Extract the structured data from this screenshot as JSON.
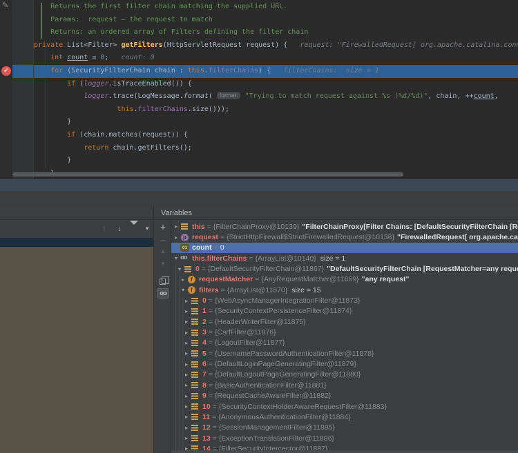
{
  "editor": {
    "breakpoint": "verified-breakpoint",
    "code_lines": [
      {
        "indent": 4,
        "name": "doc-comment-line",
        "segments": [
          {
            "t": "Returns the first filter chain matching the supplied URL.",
            "s": "cmt"
          }
        ]
      },
      {
        "indent": 4,
        "name": "doc-comment-line",
        "segments": [
          {
            "t": "Params:  request – the request to match",
            "s": "cmt"
          }
        ]
      },
      {
        "indent": 4,
        "name": "doc-comment-line",
        "segments": [
          {
            "t": "Returns: an ordered array of Filters defining the filter chain",
            "s": "cmt"
          }
        ]
      },
      {
        "indent": 0,
        "name": "method-signature-line",
        "segments": [
          {
            "t": "private",
            "s": "kw"
          },
          {
            "t": " List<Filter> ",
            "s": "pl"
          },
          {
            "t": "getFilters",
            "s": "mth"
          },
          {
            "t": "(HttpServletRequest request) {",
            "s": "pl"
          },
          {
            "t": "   request: \"FirewalledRequest[ org.apache.catalina.conn",
            "s": "hint"
          }
        ]
      },
      {
        "indent": 4,
        "name": "code-line",
        "segments": [
          {
            "t": "int ",
            "s": "kw"
          },
          {
            "t": "count",
            "s": "und"
          },
          {
            "t": " = ",
            "s": "pl"
          },
          {
            "t": "0",
            "s": "num"
          },
          {
            "t": ";",
            "s": "pl"
          },
          {
            "t": "   count: 0",
            "s": "hint"
          }
        ]
      },
      {
        "indent": 4,
        "name": "execution-line",
        "segments": [
          {
            "t": "for",
            "s": "kw"
          },
          {
            "t": " (SecurityFilterChain chain : ",
            "s": "pl"
          },
          {
            "t": "this",
            "s": "kw"
          },
          {
            "t": ".",
            "s": "pl"
          },
          {
            "t": "filterChains",
            "s": "fld"
          },
          {
            "t": ") {",
            "s": "pl"
          },
          {
            "t": "   filterChains:  size = 1",
            "s": "hint"
          }
        ]
      },
      {
        "indent": 8,
        "name": "code-line",
        "segments": [
          {
            "t": "if",
            "s": "kw"
          },
          {
            "t": " (",
            "s": "pl"
          },
          {
            "t": "logger",
            "s": "fldi"
          },
          {
            "t": ".isTraceEnabled()) {",
            "s": "pl"
          }
        ]
      },
      {
        "indent": 12,
        "name": "code-line",
        "segments": [
          {
            "t": "logger",
            "s": "fldi"
          },
          {
            "t": ".trace(LogMessage.",
            "s": "pl"
          },
          {
            "t": "format",
            "s": "pli"
          },
          {
            "t": "( ",
            "s": "pl"
          },
          {
            "t": "format:",
            "s": "chip"
          },
          {
            "t": " \"Trying to match request against %s (%d/%d)\"",
            "s": "str"
          },
          {
            "t": ", chain, ++",
            "s": "pl"
          },
          {
            "t": "count",
            "s": "und"
          },
          {
            "t": ",",
            "s": "pl"
          }
        ]
      },
      {
        "indent": 20,
        "name": "code-line",
        "segments": [
          {
            "t": "this",
            "s": "kw"
          },
          {
            "t": ".",
            "s": "pl"
          },
          {
            "t": "filterChains",
            "s": "fld"
          },
          {
            "t": ".size()));",
            "s": "pl"
          }
        ]
      },
      {
        "indent": 8,
        "name": "code-line",
        "segments": [
          {
            "t": "}",
            "s": "pl"
          }
        ]
      },
      {
        "indent": 8,
        "name": "code-line",
        "segments": [
          {
            "t": "if",
            "s": "kw"
          },
          {
            "t": " (chain.matches(request)) {",
            "s": "pl"
          }
        ]
      },
      {
        "indent": 12,
        "name": "code-line",
        "segments": [
          {
            "t": "return",
            "s": "kw"
          },
          {
            "t": " chain.getFilters();",
            "s": "pl"
          }
        ]
      },
      {
        "indent": 8,
        "name": "code-line",
        "segments": [
          {
            "t": "}",
            "s": "pl"
          }
        ]
      },
      {
        "indent": 4,
        "name": "code-line",
        "segments": [
          {
            "t": "}",
            "s": "pl"
          }
        ]
      }
    ]
  },
  "debugger": {
    "variables_panel_title": "Variables",
    "frames_toolbar": [
      {
        "icon": "arrow-up-icon",
        "glyph": "↑",
        "dim": true
      },
      {
        "icon": "arrow-down-icon",
        "glyph": "↓",
        "dim": false
      },
      {
        "icon": "filter-icon"
      },
      {
        "icon": "chevron-down-icon",
        "glyph": "▾",
        "dim": false
      }
    ],
    "watch_toolbar": [
      {
        "icon": "add-watch-icon",
        "glyph": "+"
      },
      {
        "icon": "remove-watch-icon",
        "glyph": "−"
      },
      {
        "icon": "move-up-icon",
        "glyph": "▲"
      },
      {
        "icon": "move-down-icon",
        "glyph": "▼"
      },
      {
        "icon": "duplicate-icon"
      },
      {
        "icon": "show-watches-toggle",
        "glyph": "oo"
      }
    ],
    "variables": [
      {
        "level": 0,
        "expand": "closed",
        "icon": "bars",
        "name": "this",
        "ref": "{FilterChainProxy@10139}",
        "str": "\"FilterChainProxy[Filter Chains: [DefaultSecurityFilterChain [RequestMatcher=any req"
      },
      {
        "level": 0,
        "expand": "closed",
        "icon": "param",
        "name": "request",
        "ref": "{StrictHttpFirewall$StrictFirewalledRequest@10138}",
        "str": "\"FirewalledRequest[ org.apache.catalina.connector.Requ"
      },
      {
        "level": 0,
        "expand": "none",
        "icon": "prim",
        "name": "count",
        "val": "0",
        "selected": true
      },
      {
        "level": 0,
        "expand": "open",
        "icon": "watch",
        "name": "this.filterChains",
        "ref": "{ArrayList@10140}",
        "size": "size = 1"
      },
      {
        "level": 1,
        "expand": "open",
        "icon": "bars",
        "name": "0",
        "ref": "{DefaultSecurityFilterChain@11867}",
        "str": "\"DefaultSecurityFilterChain [RequestMatcher=any request, Filters=[org.spring"
      },
      {
        "level": 2,
        "expand": "closed",
        "icon": "field",
        "name": "requestMatcher",
        "ref": "{AnyRequestMatcher@11869}",
        "str": "\"any request\""
      },
      {
        "level": 2,
        "expand": "open",
        "icon": "field",
        "name": "filters",
        "ref": "{ArrayList@11870}",
        "size": "size = 15"
      },
      {
        "level": 3,
        "expand": "closed",
        "icon": "bars",
        "name": "0",
        "ref": "{WebAsyncManagerIntegrationFilter@11873}"
      },
      {
        "level": 3,
        "expand": "closed",
        "icon": "bars",
        "name": "1",
        "ref": "{SecurityContextPersistenceFilter@11874}"
      },
      {
        "level": 3,
        "expand": "closed",
        "icon": "bars",
        "name": "2",
        "ref": "{HeaderWriterFilter@11875}"
      },
      {
        "level": 3,
        "expand": "closed",
        "icon": "bars",
        "name": "3",
        "ref": "{CsrfFilter@11876}"
      },
      {
        "level": 3,
        "expand": "closed",
        "icon": "bars",
        "name": "4",
        "ref": "{LogoutFilter@11877}"
      },
      {
        "level": 3,
        "expand": "closed",
        "icon": "bars",
        "name": "5",
        "ref": "{UsernamePasswordAuthenticationFilter@11878}"
      },
      {
        "level": 3,
        "expand": "closed",
        "icon": "bars",
        "name": "6",
        "ref": "{DefaultLoginPageGeneratingFilter@11879}"
      },
      {
        "level": 3,
        "expand": "closed",
        "icon": "bars",
        "name": "7",
        "ref": "{DefaultLogoutPageGeneratingFilter@11880}"
      },
      {
        "level": 3,
        "expand": "closed",
        "icon": "bars",
        "name": "8",
        "ref": "{BasicAuthenticationFilter@11881}"
      },
      {
        "level": 3,
        "expand": "closed",
        "icon": "bars",
        "name": "9",
        "ref": "{RequestCacheAwareFilter@11882}"
      },
      {
        "level": 3,
        "expand": "closed",
        "icon": "bars",
        "name": "10",
        "ref": "{SecurityContextHolderAwareRequestFilter@11883}"
      },
      {
        "level": 3,
        "expand": "closed",
        "icon": "bars",
        "name": "11",
        "ref": "{AnonymousAuthenticationFilter@11884}"
      },
      {
        "level": 3,
        "expand": "closed",
        "icon": "bars",
        "name": "12",
        "ref": "{SessionManagementFilter@11885}"
      },
      {
        "level": 3,
        "expand": "closed",
        "icon": "bars",
        "name": "13",
        "ref": "{ExceptionTranslationFilter@11886}"
      },
      {
        "level": 3,
        "expand": "closed",
        "icon": "bars",
        "name": "14",
        "ref": "{FilterSecurityInterceptor@11887}"
      }
    ]
  },
  "colors": {
    "execution_line_blue": "#2D6196",
    "selection_blue": "#4F6FA8",
    "breakpoint_red": "#DB5855",
    "empty_area_brown": "#575146",
    "panel_bg": "#3C3F41",
    "editor_bg": "#2B2B2B"
  }
}
